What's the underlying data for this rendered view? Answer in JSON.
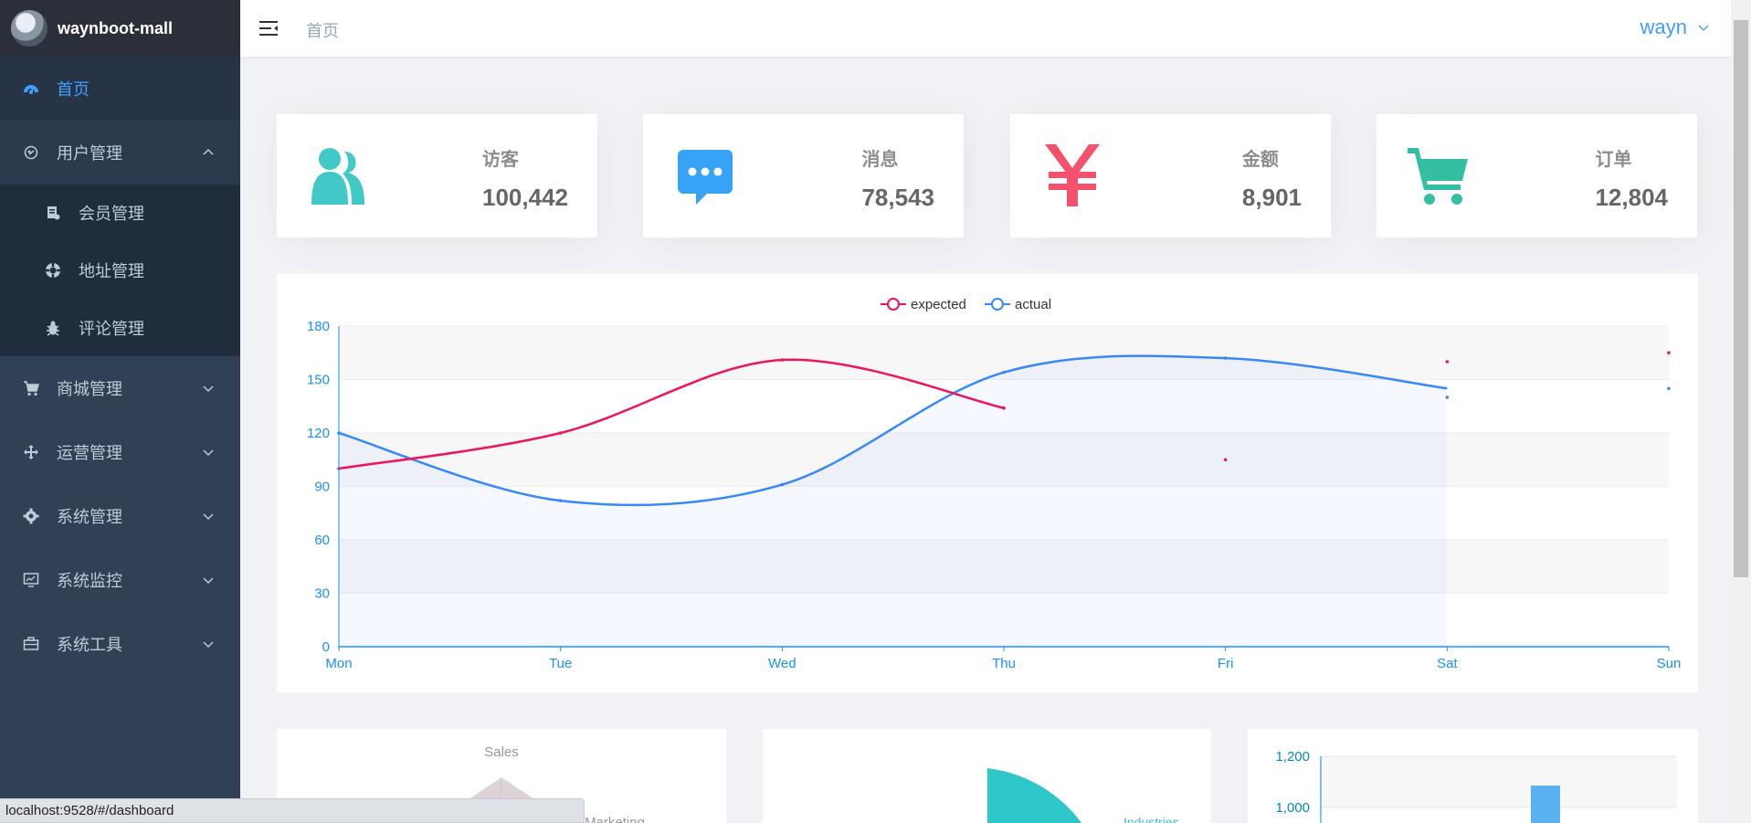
{
  "app": {
    "brand": "waynboot-mall"
  },
  "header": {
    "breadcrumb": "首页",
    "username": "wayn"
  },
  "sidebar": {
    "items": [
      {
        "label": "首页",
        "icon": "dashboard-icon",
        "active": true
      },
      {
        "label": "用户管理",
        "icon": "user-manage-icon",
        "expanded": true,
        "children": [
          {
            "label": "会员管理",
            "icon": "member-icon"
          },
          {
            "label": "地址管理",
            "icon": "address-icon"
          },
          {
            "label": "评论管理",
            "icon": "comment-icon"
          }
        ]
      },
      {
        "label": "商城管理",
        "icon": "cart-icon"
      },
      {
        "label": "运营管理",
        "icon": "move-icon"
      },
      {
        "label": "系统管理",
        "icon": "gear-icon"
      },
      {
        "label": "系统监控",
        "icon": "monitor-icon"
      },
      {
        "label": "系统工具",
        "icon": "toolbox-icon"
      }
    ]
  },
  "stats": [
    {
      "label": "访客",
      "value": "100,442",
      "icon": "visitors-icon",
      "color": "#40c9c6"
    },
    {
      "label": "消息",
      "value": "78,543",
      "icon": "message-icon",
      "color": "#36a3f7"
    },
    {
      "label": "金额",
      "value": "8,901",
      "icon": "yen-icon",
      "color": "#f4516c"
    },
    {
      "label": "订单",
      "value": "12,804",
      "icon": "shopping-cart-icon",
      "color": "#34bfa3"
    }
  ],
  "chart_data": {
    "type": "line",
    "categories": [
      "Mon",
      "Tue",
      "Wed",
      "Thu",
      "Fri",
      "Sat",
      "Sun"
    ],
    "series": [
      {
        "name": "expected",
        "color": "#f0145a",
        "line_values": [
          100,
          120,
          161,
          134
        ],
        "values": [
          100,
          120,
          161,
          134,
          105,
          160,
          165
        ]
      },
      {
        "name": "actual",
        "color": "#3888fa",
        "line_values": [
          120,
          82,
          91,
          154,
          162,
          145
        ],
        "values": [
          120,
          82,
          91,
          154,
          162,
          140,
          145
        ]
      }
    ],
    "yticks": [
      "0",
      "30",
      "60",
      "90",
      "120",
      "150",
      "180"
    ],
    "ylim": [
      0,
      180
    ],
    "legend": "top-center",
    "axis_color": "#1890ff"
  },
  "bottom": {
    "radar_label": "Sales",
    "radar_label2": "Marketing",
    "pie_label": "Industries",
    "bar_ticks": [
      "1,200",
      "1,000"
    ]
  },
  "statusbar": "localhost:9528/#/dashboard"
}
